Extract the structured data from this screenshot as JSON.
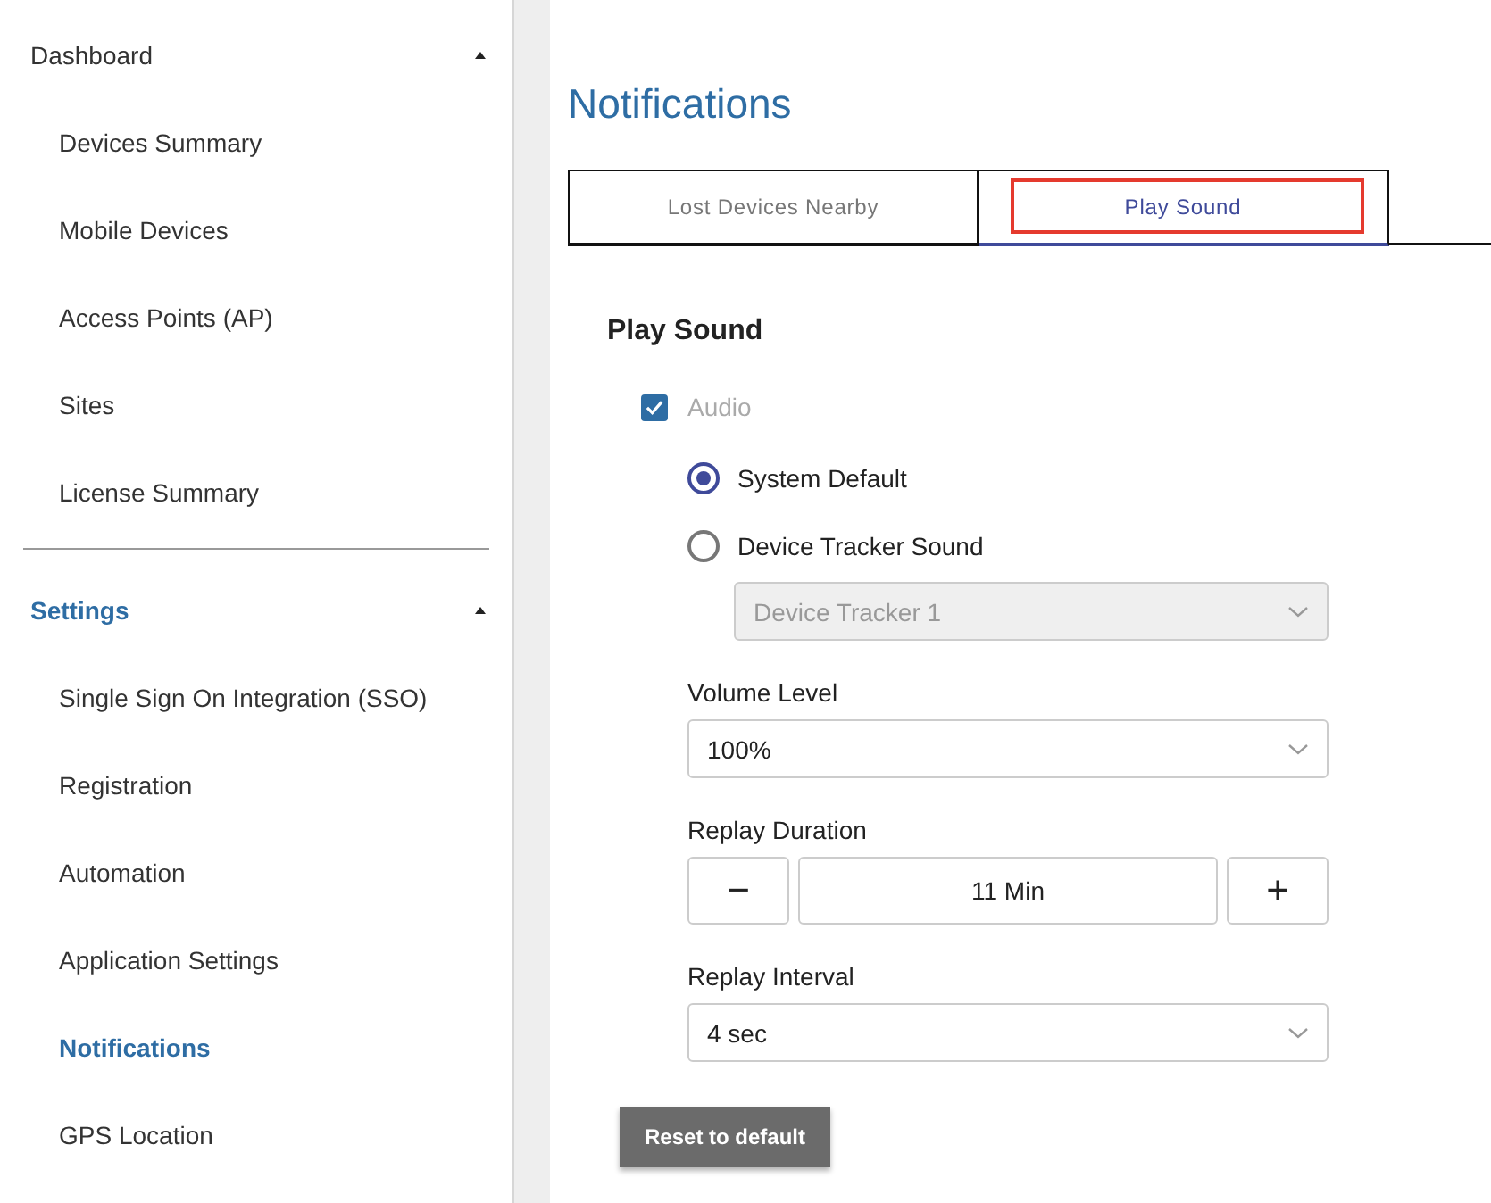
{
  "sidebar": {
    "groups": [
      {
        "title": "Dashboard",
        "expanded": true,
        "selected": false,
        "items": [
          {
            "label": "Devices Summary",
            "selected": false
          },
          {
            "label": "Mobile Devices",
            "selected": false
          },
          {
            "label": "Access Points (AP)",
            "selected": false
          },
          {
            "label": "Sites",
            "selected": false
          },
          {
            "label": "License Summary",
            "selected": false
          }
        ]
      },
      {
        "title": "Settings",
        "expanded": true,
        "selected": true,
        "items": [
          {
            "label": "Single Sign On Integration (SSO)",
            "selected": false
          },
          {
            "label": "Registration",
            "selected": false
          },
          {
            "label": "Automation",
            "selected": false
          },
          {
            "label": "Application Settings",
            "selected": false
          },
          {
            "label": "Notifications",
            "selected": true
          },
          {
            "label": "GPS Location",
            "selected": false
          }
        ]
      }
    ]
  },
  "page_title": "Notifications",
  "tabs": [
    {
      "label": "Lost Devices Nearby",
      "selected": false,
      "highlighted": false
    },
    {
      "label": "Play Sound",
      "selected": true,
      "highlighted": true
    }
  ],
  "section": {
    "title": "Play Sound",
    "audio": {
      "label": "Audio",
      "checked": true,
      "disabled": true
    },
    "sound_options": [
      {
        "label": "System Default",
        "selected": true
      },
      {
        "label": "Device Tracker Sound",
        "selected": false
      }
    ],
    "tracker_select": {
      "value": "Device Tracker 1",
      "disabled": true
    },
    "volume": {
      "label": "Volume Level",
      "value": "100%"
    },
    "replay_duration": {
      "label": "Replay Duration",
      "decrement": "−",
      "value": "11 Min",
      "increment": "+"
    },
    "replay_interval": {
      "label": "Replay Interval",
      "value": "4 sec"
    },
    "reset_button": "Reset to default"
  }
}
